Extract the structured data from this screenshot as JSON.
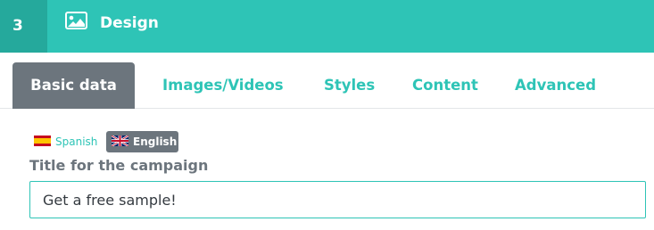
{
  "header": {
    "step_number": "3",
    "icon": "image-icon",
    "title": "Design",
    "background_color": "#2ec4b6",
    "step_background_color": "#25a99c"
  },
  "tabs": [
    {
      "label": "Basic data",
      "active": true
    },
    {
      "label": "Images/Videos",
      "active": false
    },
    {
      "label": "Styles",
      "active": false
    },
    {
      "label": "Content",
      "active": false
    },
    {
      "label": "Advanced",
      "active": false
    }
  ],
  "languages": [
    {
      "label": "Spanish",
      "flag": "spain-flag-icon",
      "active": false
    },
    {
      "label": "English",
      "flag": "uk-flag-icon",
      "active": true
    }
  ],
  "field": {
    "label": "Title for the campaign",
    "value": "Get a free sample!"
  },
  "colors": {
    "accent": "#2ec4b6",
    "active_tab": "#6c757d",
    "label_text": "#6c757d"
  }
}
